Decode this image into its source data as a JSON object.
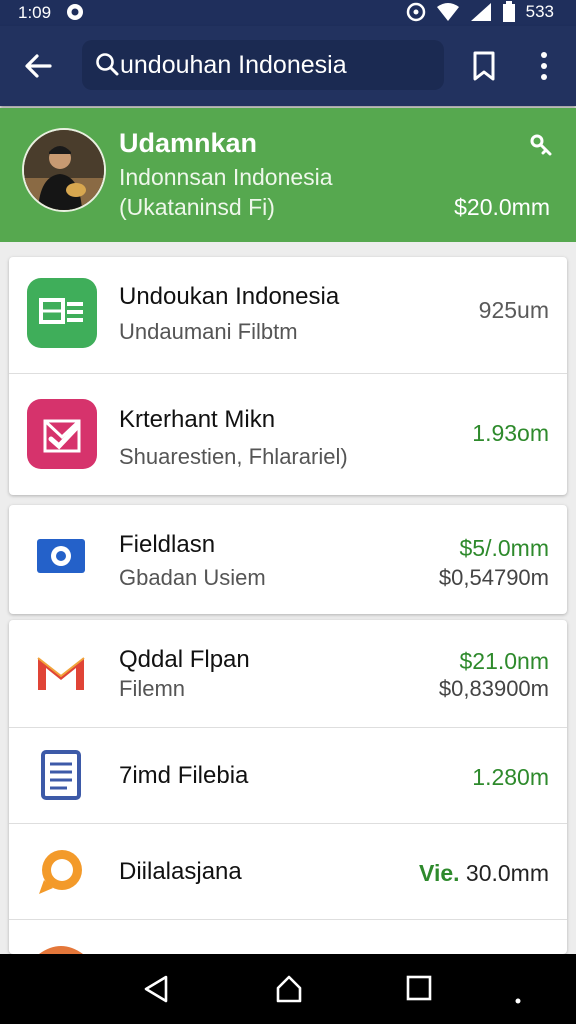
{
  "status_bar": {
    "time": "1:09",
    "battery": "533"
  },
  "search": {
    "value": "undouhan Indonesia"
  },
  "profile": {
    "name": "Udamnkan",
    "subtitle": "Indonnsan Indonesia",
    "detail": "(Ukataninsd Fi)",
    "amount": "$20.0mm"
  },
  "list": [
    {
      "title": "Undoukan Indonesia",
      "sub": "Undaumani Filbtm",
      "value": "925um",
      "value_color": "grey",
      "icon": "sheets-icon"
    },
    {
      "title": "Krterhant Mikn",
      "sub": "Shuarestien, Fhlarariel)",
      "value": "1.93om",
      "value_color": "green",
      "icon": "checklist-icon"
    },
    {
      "title": "Fieldlasn",
      "sub": "Gbadan Usiem",
      "value": "$5/.0mm",
      "value2": "$0,54790m",
      "value_color": "green",
      "icon": "camera-icon"
    },
    {
      "title": "Qddal Flpan",
      "sub": "Filemn",
      "value": "$21.0nm",
      "value2": "$0,83900m",
      "value_color": "green",
      "icon": "mail-icon"
    },
    {
      "title": "7imd Filebia",
      "sub": "",
      "value": "1.280m",
      "value_color": "green",
      "icon": "document-icon"
    },
    {
      "title": "Diilalasjana",
      "sub": "",
      "value_prefix": "Vie.",
      "value": "30.0mm",
      "value_color": "grey",
      "icon": "chat-icon"
    }
  ],
  "colors": {
    "toolbar": "#22325f",
    "profile_bg": "#56a84f",
    "value_green": "#2e8a2c"
  }
}
